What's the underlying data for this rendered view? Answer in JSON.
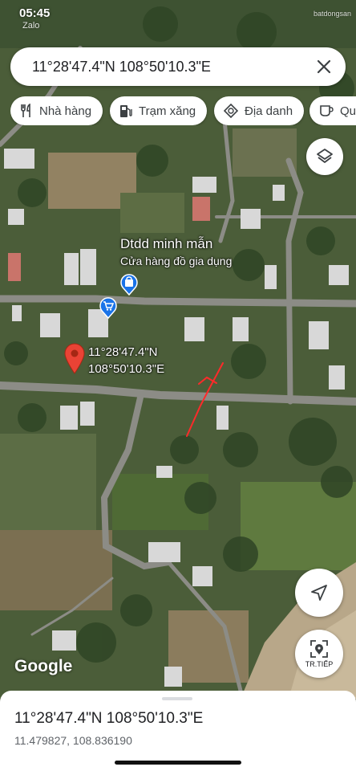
{
  "status": {
    "time": "05:45",
    "sub": "Zalo",
    "watermark": "batdongsan"
  },
  "search": {
    "query": "11°28'47.4\"N 108°50'10.3\"E"
  },
  "chips": [
    {
      "label": "Nhà hàng",
      "icon": "restaurant-icon"
    },
    {
      "label": "Trạm xăng",
      "icon": "gas-station-icon"
    },
    {
      "label": "Địa danh",
      "icon": "landmark-icon"
    },
    {
      "label": "Quán cà phê",
      "icon": "coffee-icon"
    }
  ],
  "poi": {
    "name": "Dtdd minh mẫn",
    "category": "Cửa hàng đồ gia dụng"
  },
  "pin": {
    "line1": "11°28'47.4\"N",
    "line2": "108°50'10.3\"E"
  },
  "buttons": {
    "start_label": "TR.TIẾP"
  },
  "logo": "Google",
  "sheet": {
    "title": "11°28'47.4\"N 108°50'10.3\"E",
    "coords": "11.479827, 108.836190"
  },
  "colors": {
    "pin_red": "#ea4335",
    "poi_blue": "#1a73e8",
    "annotation_red": "#ff2a2a"
  }
}
